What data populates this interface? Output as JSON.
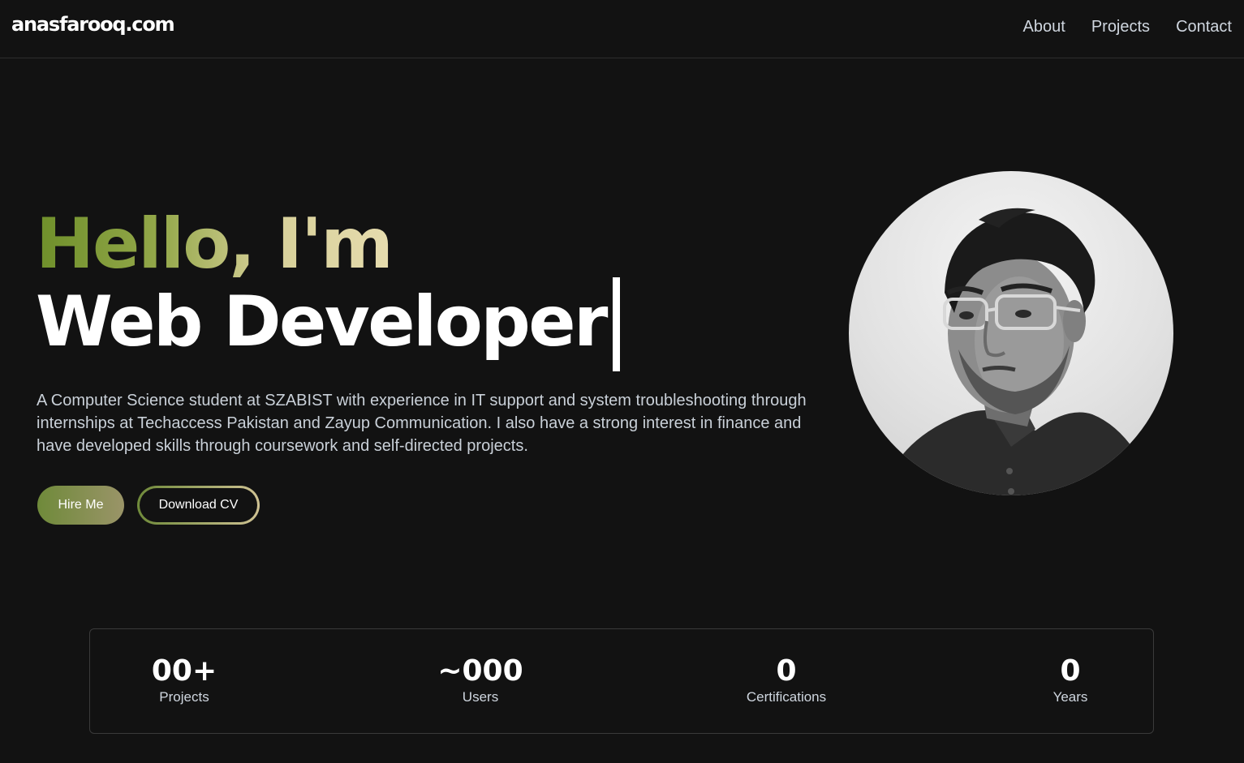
{
  "nav": {
    "logo": "anasfarooq.com",
    "links": [
      "About",
      "Projects",
      "Contact"
    ]
  },
  "hero": {
    "greeting": "Hello, I'm",
    "role": "Web Developer",
    "bio": "A Computer Science student at SZABIST with experience in IT support and system troubleshooting through internships at Techaccess Pakistan and Zayup Communication. I also have a strong interest in finance and have developed skills through coursework and self-directed projects.",
    "buttons": {
      "hire": "Hire Me",
      "cv": "Download CV"
    }
  },
  "stats": [
    {
      "value": "00+",
      "label": "Projects"
    },
    {
      "value": "~000",
      "label": "Users"
    },
    {
      "value": "0",
      "label": "Certifications"
    },
    {
      "value": "0",
      "label": "Years"
    }
  ],
  "colors": {
    "background": "#121212",
    "accent_green": "#6e8f2a",
    "accent_cream": "#e6dcae"
  }
}
